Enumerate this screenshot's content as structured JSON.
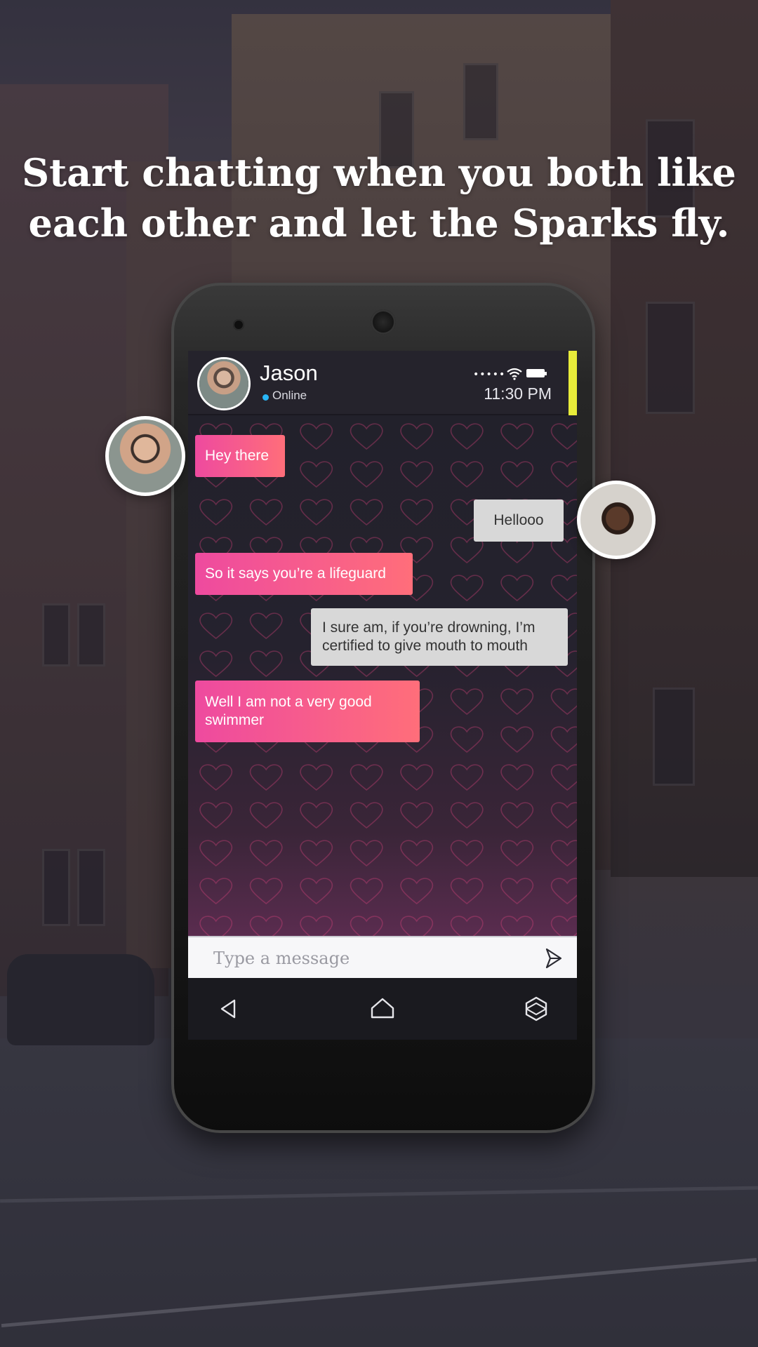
{
  "headline": {
    "line1": "Start chatting when you both like",
    "line2": "each other and let the Sparks fly."
  },
  "chat_header": {
    "contact_name": "Jason",
    "status": "Online",
    "time": "11:30 PM",
    "signal_dots": "•••••"
  },
  "messages": [
    {
      "text": "Hey there",
      "from": "them"
    },
    {
      "text": "Hellooo",
      "from": "me"
    },
    {
      "text": "So it says you’re a lifeguard",
      "from": "them"
    },
    {
      "text": "I sure am, if you’re drowning, I’m certified to give mouth to mouth",
      "from": "me"
    },
    {
      "text": "Well I am not a very good swimmer",
      "from": "them"
    }
  ],
  "composer": {
    "placeholder": "Type a message"
  },
  "colors": {
    "bubble_gradient_start": "#ee4a9f",
    "bubble_gradient_end": "#ff6e7a",
    "accent_bar": "#e8ec3a",
    "online_dot": "#29b6f6"
  },
  "icons": {
    "send": "send-icon",
    "back": "back-triangle-icon",
    "home": "home-icon",
    "recents": "recents-hexagon-icon"
  }
}
